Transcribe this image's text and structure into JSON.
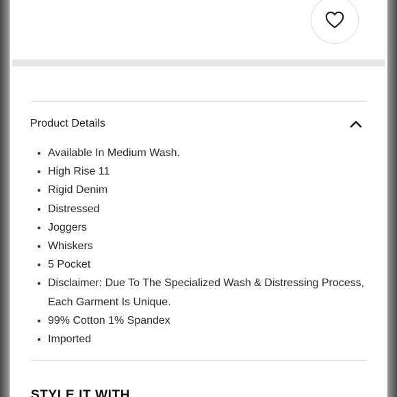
{
  "favorite": {
    "icon": "heart-icon"
  },
  "product_details": {
    "title": "Product Details",
    "toggle_icon": "chevron-up-icon",
    "items": [
      "Available In Medium Wash.",
      "High Rise 11",
      "Rigid Denim",
      "Distressed",
      "Joggers",
      "Whiskers",
      "5 Pocket",
      "Disclaimer: Due To The Specialized Wash & Distressing Process, Each Garment Is Unique.",
      "99% Cotton 1% Spandex",
      "Imported"
    ]
  },
  "style_it_with": {
    "heading": "STYLE IT WITH"
  }
}
